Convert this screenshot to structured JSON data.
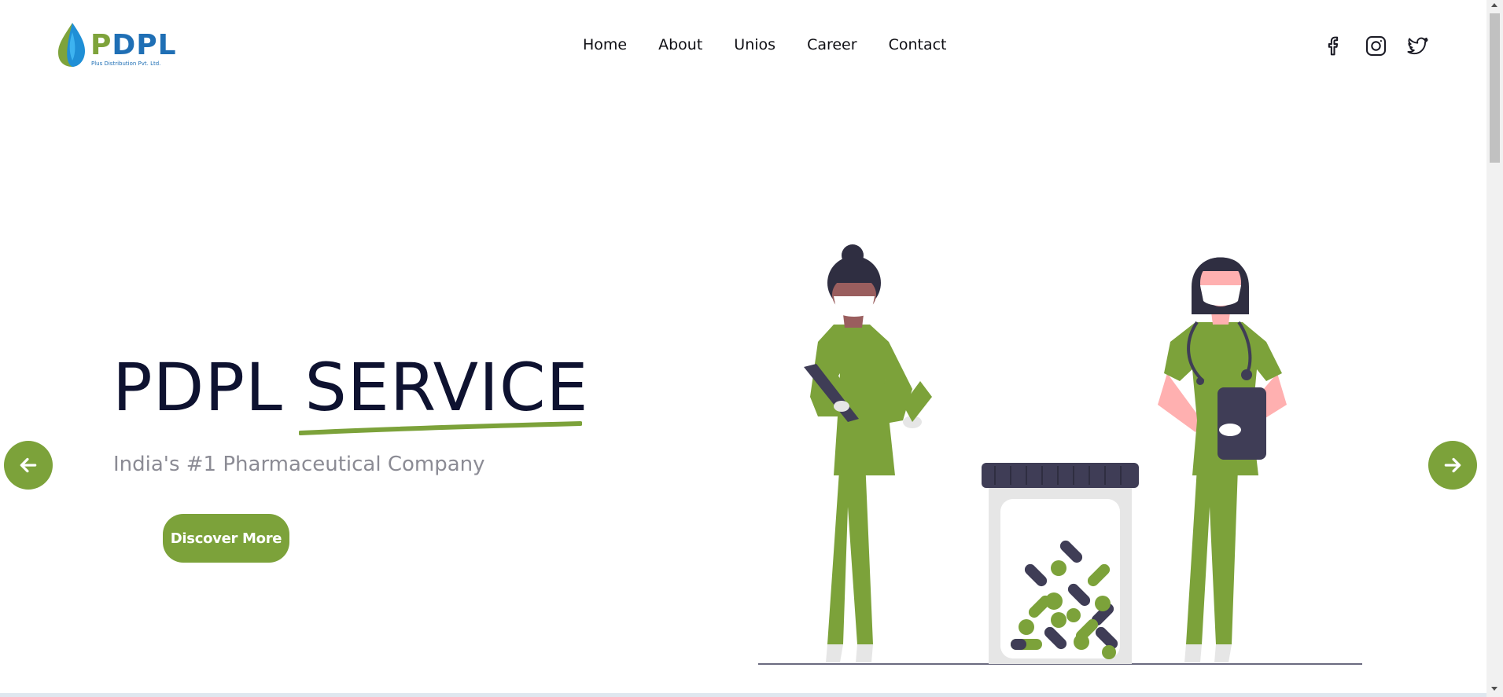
{
  "header": {
    "logo": {
      "text_first": "P",
      "text_rest": "DPL",
      "subtitle": "Plus Distribution Pvt. Ltd."
    },
    "nav": [
      {
        "label": "Home"
      },
      {
        "label": "About"
      },
      {
        "label": "Unios"
      },
      {
        "label": "Career"
      },
      {
        "label": "Contact"
      }
    ],
    "social": [
      {
        "icon": "facebook-icon"
      },
      {
        "icon": "instagram-icon"
      },
      {
        "icon": "twitter-icon"
      }
    ]
  },
  "hero": {
    "title": "PDPL SERVICE",
    "subtitle": "India's #1 Pharmaceutical Company",
    "cta_label": "Discover More",
    "prev_icon": "arrow-left-icon",
    "next_icon": "arrow-right-icon"
  },
  "colors": {
    "accent": "#7ca23a",
    "brand_blue": "#1f6fb5",
    "title": "#0e1230",
    "subtitle": "#8b8b94",
    "dark": "#3f3d56"
  }
}
